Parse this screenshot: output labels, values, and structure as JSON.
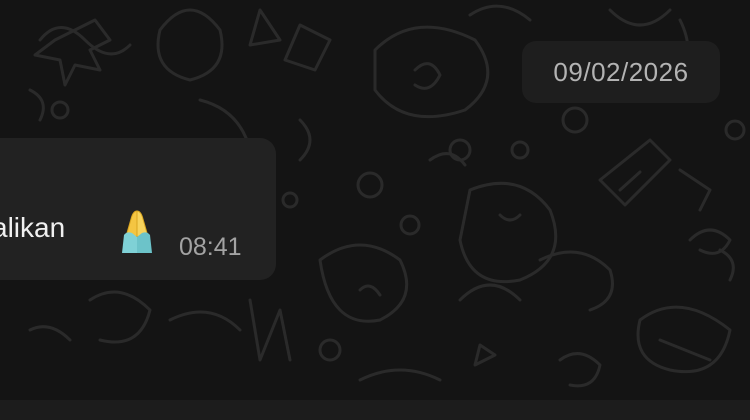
{
  "chat": {
    "date_separator": "09/02/2026",
    "message": {
      "text": "alikan",
      "emoji": "pray-emoji",
      "time": "08:41"
    }
  },
  "colors": {
    "background": "#141414",
    "bubble": "#222222",
    "date_chip": "#1e1e1e",
    "text": "#f0f0f0",
    "muted": "#a3a3a3",
    "emoji_skin": "#f4c542",
    "emoji_sleeve": "#7fd1d6"
  }
}
